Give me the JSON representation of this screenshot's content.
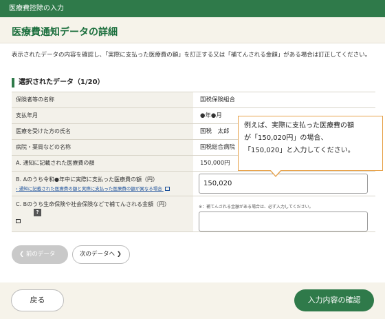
{
  "topbar": {
    "title": "医療費控除の入力"
  },
  "page": {
    "title": "医療費通知データの詳細",
    "description": "表示されたデータの内容を確認し、「実際に支払った医療費の額」を訂正する又は「補てんされる金額」がある場合は訂正してください。"
  },
  "section": {
    "title": "選択されたデータ（1/20）"
  },
  "rows": [
    {
      "label": "保険者等の名称",
      "value": "国税保険組合"
    },
    {
      "label": "支払年月",
      "value": "●年●月"
    },
    {
      "label": "医療を受けた方の氏名",
      "value": "国税　太郎"
    },
    {
      "label": "病院・薬局などの名称",
      "value": "国税総合病院"
    },
    {
      "label": "A. 通知に記載された医療費の額",
      "value": "150,000円"
    }
  ],
  "row_b": {
    "label": "B. Aのうち令和●年中に実際に支払った医療費の額（円）",
    "link": "通知に記載された医療費の額と実際に支払った医療費の額が異なる場合",
    "input_value": "150,020"
  },
  "row_c": {
    "label": "C. Bのうち生命保険や社会保険などで補てんされる金額（円）",
    "help_badge": "?",
    "note": "※：補てんされる金額がある場合は、必ず入力してください。",
    "input_value": ""
  },
  "callout": {
    "line1": "例えば、実際に支払った医療費の額",
    "line2": "が「150,020円」の場合、",
    "line3": "「150,020」と入力してください。"
  },
  "pager": {
    "prev_label": "前のデータへ",
    "next_label": "次のデータへ"
  },
  "footer": {
    "back_label": "戻る",
    "confirm_label": "入力内容の確認"
  },
  "colors": {
    "brand_green": "#2f7a4a",
    "callout_border": "#e7a24a",
    "link": "#1a4f9a"
  },
  "icons": [
    "chevron-left-icon",
    "chevron-right-icon",
    "external-link-icon",
    "help-icon"
  ]
}
